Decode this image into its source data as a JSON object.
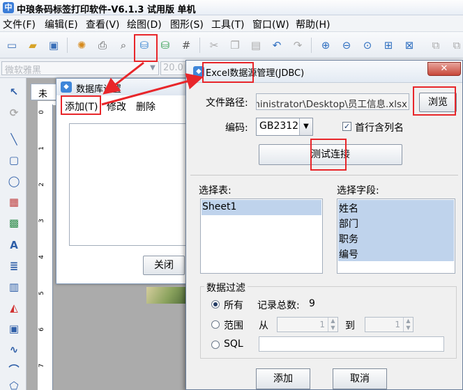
{
  "app": {
    "title": "中琅条码标签打印软件-V6.1.3 试用版 单机",
    "logo_glyph": "中",
    "menu": [
      "文件(F)",
      "编辑(E)",
      "查看(V)",
      "绘图(D)",
      "图形(S)",
      "工具(T)",
      "窗口(W)",
      "帮助(H)"
    ],
    "font_name": "微软雅黑",
    "font_size": "20.0",
    "doc_tab_label": "未",
    "ruler_marks": [
      "0",
      "1",
      "2",
      "3",
      "4",
      "5",
      "6",
      "7",
      "8"
    ]
  },
  "db_dialog": {
    "title": "数据库设置",
    "icon_glyph": "◆",
    "menu_add": "添加(T)",
    "menu_edit": "修改",
    "menu_delete": "删除",
    "close_label": "关闭"
  },
  "excel_dialog": {
    "title": "Excel数据源管理(JDBC)",
    "icon_glyph": "◆",
    "close_glyph": "✕",
    "file_path_label": "文件路径:",
    "file_path_value": "C:\\Users\\Administrator\\Desktop\\员工信息.xlsx",
    "browse_label": "浏览",
    "encoding_label": "编码:",
    "encoding_value": "GB2312",
    "first_row_header_label": "首行含列名",
    "first_row_header_checked": true,
    "test_connection_label": "测试连接",
    "select_table_label": "选择表:",
    "tables": [
      "Sheet1"
    ],
    "select_fields_label": "选择字段:",
    "fields": [
      "姓名",
      "部门",
      "职务",
      "编号"
    ],
    "filter_label": "数据过滤",
    "radio_all": "所有",
    "record_total_label": "记录总数:",
    "record_total_value": "9",
    "radio_range": "范围",
    "range_from_label": "从",
    "range_from_value": "1",
    "range_to_label": "到",
    "range_to_value": "1",
    "radio_sql": "SQL",
    "add_label": "添加",
    "cancel_label": "取消"
  },
  "colors": {
    "annotation": "#e8262a",
    "selection": "#bfd3ec"
  }
}
